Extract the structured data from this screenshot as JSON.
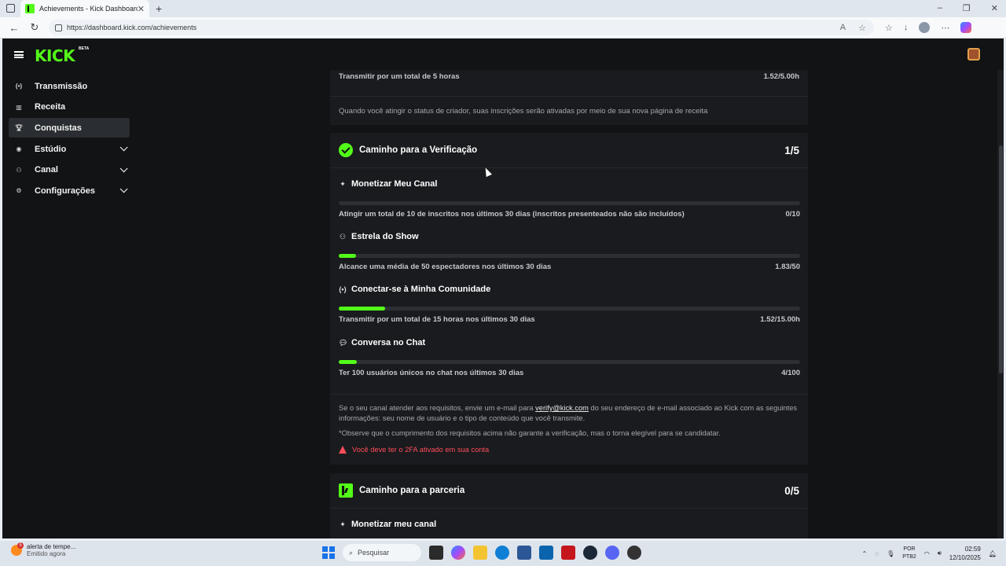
{
  "browser": {
    "tab_title": "Achievements - Kick Dashboard",
    "url": "https://dashboard.kick.com/achievements"
  },
  "app": {
    "logo": "KICK",
    "logo_badge": "BETA"
  },
  "sidebar": {
    "items": [
      {
        "label": "Transmissão",
        "icon": "broadcast-icon"
      },
      {
        "label": "Receita",
        "icon": "revenue-icon"
      },
      {
        "label": "Conquistas",
        "icon": "trophy-icon",
        "active": true
      },
      {
        "label": "Estúdio",
        "icon": "studio-icon",
        "expandable": true
      },
      {
        "label": "Canal",
        "icon": "channel-icon",
        "expandable": true
      },
      {
        "label": "Configurações",
        "icon": "gear-icon",
        "expandable": true
      }
    ]
  },
  "creator_card": {
    "req_desc": "Transmitir por um total de 5 horas",
    "req_value": "1.52/5.00h",
    "note": "Quando você atingir o status de criador, suas inscrições serão ativadas por meio de sua nova página de receita"
  },
  "verification": {
    "title": "Caminho para a Verificação",
    "count": "1/5",
    "requirements": [
      {
        "title": "Monetizar Meu Canal",
        "icon": "sparkle-icon",
        "desc": "Atingir um total de 10 de inscritos nos últimos 30 dias (inscritos presenteados não são incluídos)",
        "value": "0/10",
        "progress": 0
      },
      {
        "title": "Estrela do Show",
        "icon": "viewers-icon",
        "desc": "Alcance uma média de 50 espectadores nos últimos 30 dias",
        "value": "1.83/50",
        "progress": 0.037
      },
      {
        "title": "Conectar-se à Minha Comunidade",
        "icon": "broadcast-icon",
        "desc": "Transmitir por um total de 15 horas nos últimos 30 dias",
        "value": "1.52/15.00h",
        "progress": 0.101
      },
      {
        "title": "Conversa no Chat",
        "icon": "chat-icon",
        "desc": "Ter 100 usuários únicos no chat nos últimos 30 dias",
        "value": "4/100",
        "progress": 0.04
      }
    ],
    "info_before_link": "Se o seu canal atender aos requisitos, envie um e-mail para ",
    "info_link": "verify@kick.com",
    "info_after_link": " do seu endereço de e-mail associado ao Kick com as seguintes informações: seu nome de usuário e o tipo de conteúdo que você transmite.",
    "disclaimer": "*Observe que o cumprimento dos requisitos acima não garante a verificação, mas o torna elegível para se candidatar.",
    "warning": "Você deve ter o 2FA ativado em sua conta"
  },
  "partnership": {
    "title": "Caminho para a parceria",
    "count": "0/5",
    "first_requirement": "Monetizar meu canal"
  },
  "taskbar": {
    "weather_title": "alerta de tempe...",
    "weather_sub": "Emitido agora",
    "weather_badge": "5",
    "search_placeholder": "Pesquisar",
    "lang_top": "POR",
    "lang_bottom": "PTB2",
    "time": "02:59",
    "date": "12/10/2025"
  },
  "colors": {
    "accent": "#53fc18",
    "background": "#111315",
    "card": "#191b1e",
    "warning": "#ff4c5b"
  }
}
